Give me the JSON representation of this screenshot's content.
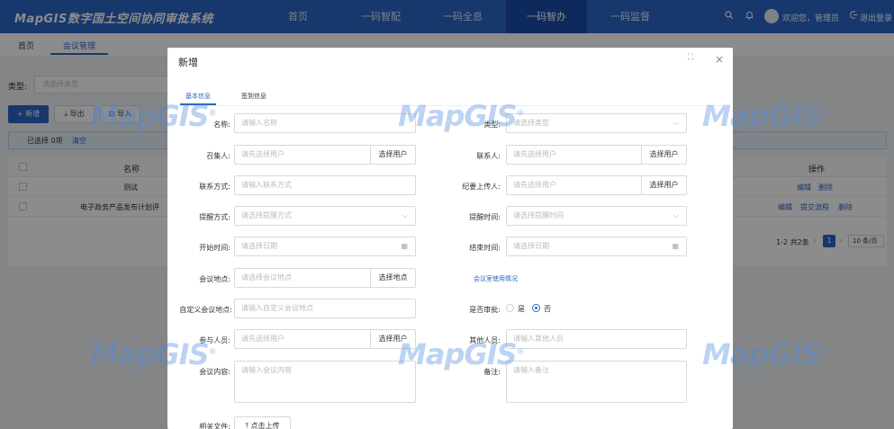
{
  "header": {
    "logo": "MapGIS数字国土空间协同审批系统",
    "nav": [
      "首页",
      "一码智配",
      "一码全息",
      "一码智办",
      "一码监督"
    ],
    "nav_active_index": 3,
    "welcome": "欢迎您，管理员",
    "logout": "退出登录"
  },
  "tabs": [
    "首页",
    "会议管理"
  ],
  "filter": {
    "type_label": "类型:",
    "type_placeholder": "请选择类型"
  },
  "toolbar": {
    "add": "+ 新增",
    "export": "导出",
    "import": "导入"
  },
  "selection": {
    "text": "已选择 0项",
    "clear": "清空"
  },
  "table": {
    "columns": {
      "name": "名称",
      "ops": "操作"
    },
    "rows": [
      {
        "name": "测试",
        "ops": [
          "编辑",
          "删除"
        ]
      },
      {
        "name": "电子政务产品发布计划评",
        "ops": [
          "编辑",
          "提交流程",
          "删除"
        ]
      }
    ]
  },
  "pagination": {
    "summary": "1-2 共2条",
    "page": "1",
    "page_size": "10 条/页"
  },
  "modal": {
    "title": "新增",
    "tabs": [
      "基本信息",
      "签到信息"
    ],
    "active_tab": 0,
    "fields": {
      "name": {
        "label": "名称:",
        "placeholder": "请输入名称"
      },
      "type": {
        "label": "类型:",
        "placeholder": "请选择类型"
      },
      "convener": {
        "label": "召集人:",
        "placeholder": "请先选择用户",
        "button": "选择用户"
      },
      "contact": {
        "label": "联系人:",
        "placeholder": "请先选择用户",
        "button": "选择用户"
      },
      "phone": {
        "label": "联系方式:",
        "placeholder": "请输入联系方式"
      },
      "uploader": {
        "label": "纪要上传人:",
        "placeholder": "请先选择用户",
        "button": "选择用户"
      },
      "remind_mode": {
        "label": "提醒方式:",
        "placeholder": "请选择提醒方式"
      },
      "remind_time": {
        "label": "提醒时间:",
        "placeholder": "请选择提醒时间"
      },
      "start_time": {
        "label": "开始时间:",
        "placeholder": "请选择日期"
      },
      "end_time": {
        "label": "结束时间:",
        "placeholder": "请选择日期"
      },
      "location": {
        "label": "会议地点:",
        "placeholder": "请选择会议地点",
        "button": "选择地点"
      },
      "room_usage_link": "会议室使用情况",
      "custom_location": {
        "label": "自定义会议地点:",
        "placeholder": "请输入自定义会议地点"
      },
      "approval": {
        "label": "是否审批:",
        "options": [
          "是",
          "否"
        ],
        "selected": "否"
      },
      "participants": {
        "label": "参与人员:",
        "placeholder": "请先选择用户",
        "button": "选择用户"
      },
      "others": {
        "label": "其他人员:",
        "placeholder": "请输入其他人员"
      },
      "content": {
        "label": "会议内容:",
        "placeholder": "请输入会议内容"
      },
      "remark": {
        "label": "备注:",
        "placeholder": "请输入备注"
      },
      "files": {
        "label": "相关文件:",
        "button": "点击上传"
      }
    }
  },
  "watermark": {
    "text": "MapGIS",
    "reg": "®"
  },
  "icons": [
    "search-icon",
    "bell-icon",
    "avatar",
    "logout-icon",
    "expand-icon",
    "close-icon",
    "calendar-icon",
    "chevron-down-icon",
    "upload-icon",
    "export-icon",
    "import-icon"
  ],
  "colors": {
    "primary": "#2b66c6",
    "header": "#2b66c6",
    "nav_active": "#1b4ea8"
  }
}
